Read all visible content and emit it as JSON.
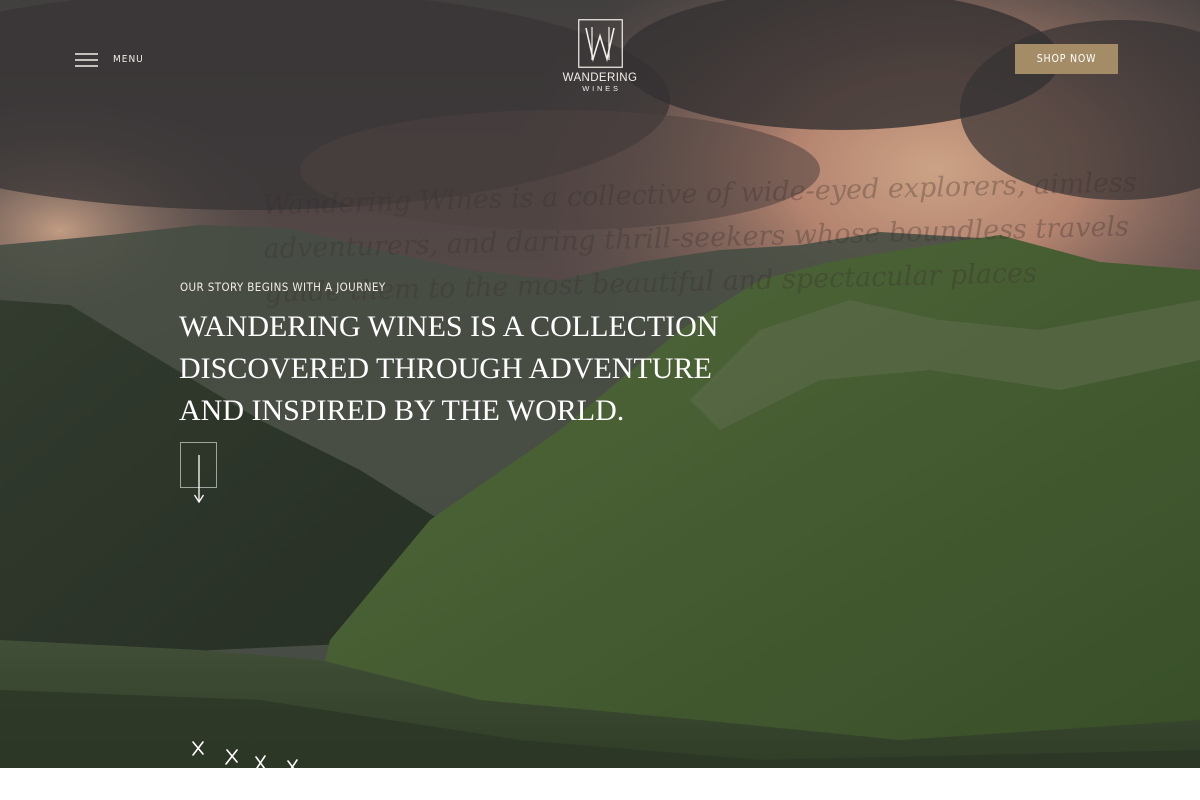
{
  "header": {
    "menu_label": "MENU",
    "brand_name": "WANDERING",
    "brand_sub": "WINES",
    "shop_label": "SHOP NOW"
  },
  "hero": {
    "eyebrow": "OUR STORY BEGINS WITH A JOURNEY",
    "headline_lines": [
      "WANDERING WINES IS A COLLECTION",
      "DISCOVERED THROUGH ADVENTURE",
      "AND INSPIRED BY THE WORLD."
    ],
    "script_lines": [
      "Wandering Wines is a collective of wide-eyed explorers, aimless",
      "adventurers, and daring thrill-seekers whose boundless travels",
      "guide them to the most beautiful and spectacular places"
    ]
  },
  "colors": {
    "accent": "#a48c67",
    "text_light": "#ffffff",
    "text_muted": "#f1ede6"
  },
  "icons": {
    "menu": "hamburger-icon",
    "logo": "logo-mark-icon",
    "scroll": "arrow-down-icon",
    "decoration": "route-marks-icon"
  }
}
